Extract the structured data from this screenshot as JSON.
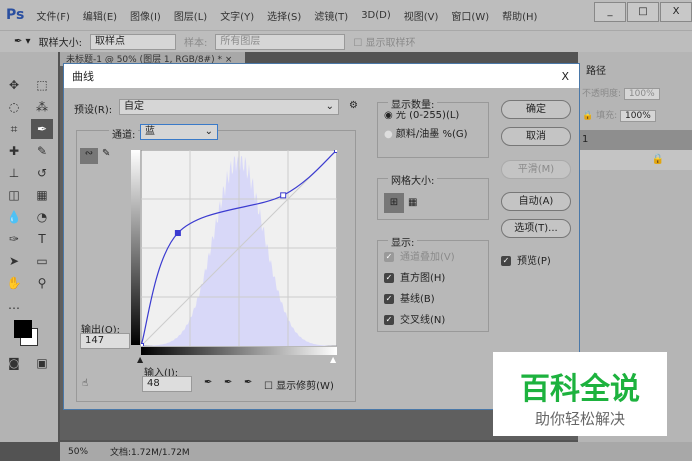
{
  "app": {
    "logo": "Ps",
    "menus": [
      "文件(F)",
      "编辑(E)",
      "图像(I)",
      "图层(L)",
      "文字(Y)",
      "选择(S)",
      "滤镜(T)",
      "3D(D)",
      "视图(V)",
      "窗口(W)",
      "帮助(H)"
    ],
    "window_buttons": [
      "_",
      "□",
      "X"
    ]
  },
  "options": {
    "sample_size_label": "取样大小:",
    "sample_size": "取样点",
    "sample_label": "样本:",
    "sample": "所有图层",
    "show_ring": "显示取样环"
  },
  "document": {
    "tab": "未标题-1 @ 50% (图层 1, RGB/8#) *  ×",
    "zoom": "50%",
    "doc_size": "文档:1.72M/1.72M"
  },
  "right_panel": {
    "tab": "路径",
    "opacity_label": "不透明度:",
    "opacity": "100%",
    "fill_label": "填充:",
    "fill": "100%",
    "layer": "1"
  },
  "dialog": {
    "title": "曲线",
    "close": "X",
    "preset_label": "预设(R):",
    "preset": "自定",
    "channel_label": "通道:",
    "channel": "蓝",
    "output_label": "输出(O):",
    "output": "147",
    "input_label": "输入(I):",
    "input": "48",
    "show_clipping": "显示修剪(W)",
    "curve_points": [
      [
        0,
        0
      ],
      [
        48,
        147
      ],
      [
        185,
        196
      ],
      [
        255,
        255
      ]
    ],
    "curve_color": "#3b3bd0",
    "histogram_color": "#d8d8f8",
    "display_amount": {
      "legend": "显示数量:",
      "light": "光 (0-255)(L)",
      "pigment": "颜料/油墨 %(G)",
      "selected": "light"
    },
    "grid_size": {
      "legend": "网格大小:"
    },
    "show": {
      "legend": "显示:",
      "items": [
        {
          "label": "通道叠加(V)",
          "checked": true,
          "disabled": true
        },
        {
          "label": "直方图(H)",
          "checked": true
        },
        {
          "label": "基线(B)",
          "checked": true
        },
        {
          "label": "交叉线(N)",
          "checked": true
        }
      ]
    },
    "buttons": {
      "ok": "确定",
      "cancel": "取消",
      "smooth": "平滑(M)",
      "auto": "自动(A)",
      "options": "选项(T)..."
    },
    "preview": "预览(P)"
  },
  "watermark": {
    "title": "百科全说",
    "subtitle": "助你轻松解决"
  }
}
